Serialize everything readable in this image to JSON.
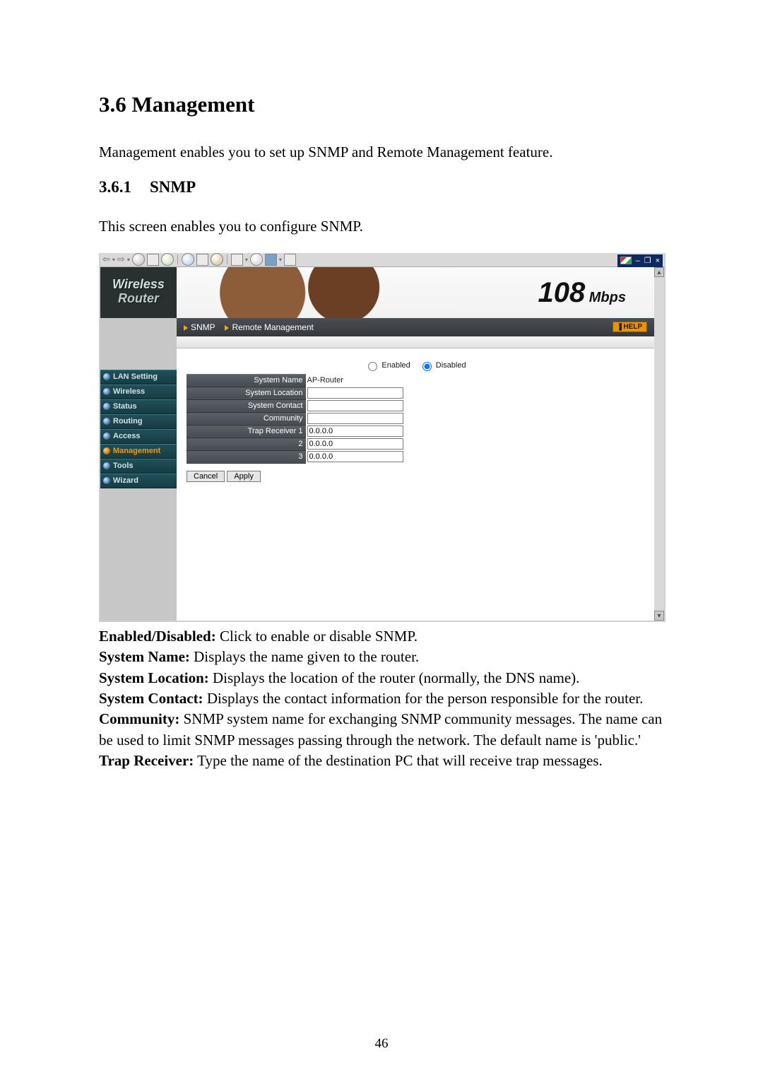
{
  "headings": {
    "main": "3.6 Management",
    "sub_num": "3.6.1",
    "sub_title": "SNMP"
  },
  "intro_p": "Management enables you to set up SNMP and Remote Management feature.",
  "sub_p": "This screen enables you to configure SNMP.",
  "page_number": "46",
  "definitions": [
    {
      "term": "Enabled/Disabled:",
      "text": " Click to enable or disable SNMP."
    },
    {
      "term": "System Name:",
      "text": " Displays the name given to the router."
    },
    {
      "term": "System Location:",
      "text": " Displays the location of the router (normally, the DNS name)."
    },
    {
      "term": "System Contact:",
      "text": " Displays the contact information for the person responsible for the router."
    },
    {
      "term": "Community:",
      "text": " SNMP system name for exchanging SNMP community messages. The name can be used to limit SNMP messages passing through the network. The default name is 'public.'"
    },
    {
      "term": "Trap Receiver:",
      "text": " Type the name of the destination PC that will receive trap messages."
    }
  ],
  "shot": {
    "titlebar": {
      "min": "–",
      "restore": "❐",
      "close": "×"
    },
    "brand_line1": "Wireless",
    "brand_line2": "Router",
    "logo_number": "108",
    "logo_unit": " Mbps",
    "tabs": {
      "snmp": "SNMP",
      "remote": "Remote Management"
    },
    "help": "HELP",
    "radio": {
      "enabled": "Enabled",
      "disabled": "Disabled",
      "selected": "disabled"
    },
    "fields": {
      "system_name_lbl": "System Name",
      "system_name_val": "AP-Router",
      "system_location_lbl": "System Location",
      "system_location_val": "",
      "system_contact_lbl": "System Contact",
      "system_contact_val": "",
      "community_lbl": "Community",
      "community_val": "",
      "trap1_lbl": "Trap Receiver 1",
      "trap1_val": "0.0.0.0",
      "trap2_lbl": "2",
      "trap2_val": "0.0.0.0",
      "trap3_lbl": "3",
      "trap3_val": "0.0.0.0"
    },
    "buttons": {
      "cancel": "Cancel",
      "apply": "Apply"
    },
    "menu": [
      {
        "label": "LAN Setting",
        "active": false
      },
      {
        "label": "Wireless",
        "active": false
      },
      {
        "label": "Status",
        "active": false
      },
      {
        "label": "Routing",
        "active": false
      },
      {
        "label": "Access",
        "active": false
      },
      {
        "label": "Management",
        "active": true
      },
      {
        "label": "Tools",
        "active": false
      },
      {
        "label": "Wizard",
        "active": false
      }
    ]
  }
}
